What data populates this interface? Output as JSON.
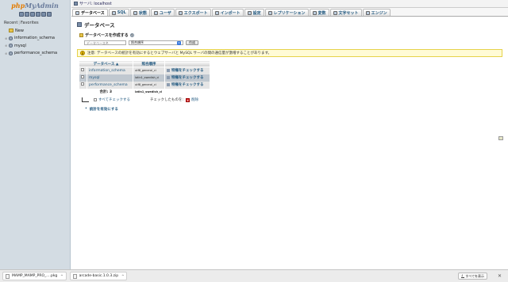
{
  "nav": {
    "logo_php": "php",
    "logo_admin": "MyAdmin",
    "tab_recent": "Recent",
    "tab_separator": "|",
    "tab_favorites": "Favorites",
    "tree": [
      {
        "label": "New",
        "icon": "new-db-icon"
      },
      {
        "label": "information_schema",
        "icon": "database-icon"
      },
      {
        "label": "mysql",
        "icon": "database-icon"
      },
      {
        "label": "performance_schema",
        "icon": "database-icon"
      }
    ]
  },
  "topbar": {
    "server": "サーバ: localhost"
  },
  "tabs": [
    {
      "label": "データベース",
      "icon": "database-icon",
      "active": true
    },
    {
      "label": "SQL",
      "icon": "sql-icon"
    },
    {
      "label": "状態",
      "icon": "status-icon"
    },
    {
      "label": "ユーザ",
      "icon": "users-icon"
    },
    {
      "label": "エクスポート",
      "icon": "export-icon"
    },
    {
      "label": "インポート",
      "icon": "import-icon"
    },
    {
      "label": "設定",
      "icon": "settings-icon"
    },
    {
      "label": "レプリケーション",
      "icon": "replication-icon"
    },
    {
      "label": "変数",
      "icon": "variables-icon"
    },
    {
      "label": "文字セット",
      "icon": "charset-icon"
    },
    {
      "label": "エンジン",
      "icon": "engines-icon"
    }
  ],
  "page": {
    "heading": "データベース",
    "create_label": "データベースを作成する",
    "help": "?",
    "dbname_placeholder": "データベース名",
    "collation_value": "照合順序",
    "create_button": "作成",
    "notice": "注意: データベースの統計を有効にするとウェブサーバと MySQL サーバの間の通信量が激増することがあります。",
    "notice_icon": "i"
  },
  "table": {
    "headers": {
      "name": "データベース ▲",
      "collation": "照合順序"
    },
    "rows": [
      {
        "name": "information_schema",
        "collation": "utf8_general_ci",
        "action": "特権をチェックする"
      },
      {
        "name": "mysql",
        "collation": "latin1_swedish_ci",
        "action": "特権をチェックする"
      },
      {
        "name": "performance_schema",
        "collation": "utf8_general_ci",
        "action": "特権をチェックする"
      }
    ],
    "total_label": "合計: 3",
    "total_collation": "latin1_swedish_ci"
  },
  "select": {
    "check_all": "すべてチェックする",
    "with_selected": "チェックしたものを:",
    "drop_icon": "x",
    "drop": "削除"
  },
  "enable_stats": "統計を有効にする",
  "downloads": {
    "items": [
      {
        "name": "MAMP_MAMP_PRO_....pkg"
      },
      {
        "name": "arcade-basic.1.0.3.zip"
      }
    ],
    "show_all": "すべてを表示",
    "show_all_icon": "↓",
    "close": "✕",
    "caret": "^"
  }
}
